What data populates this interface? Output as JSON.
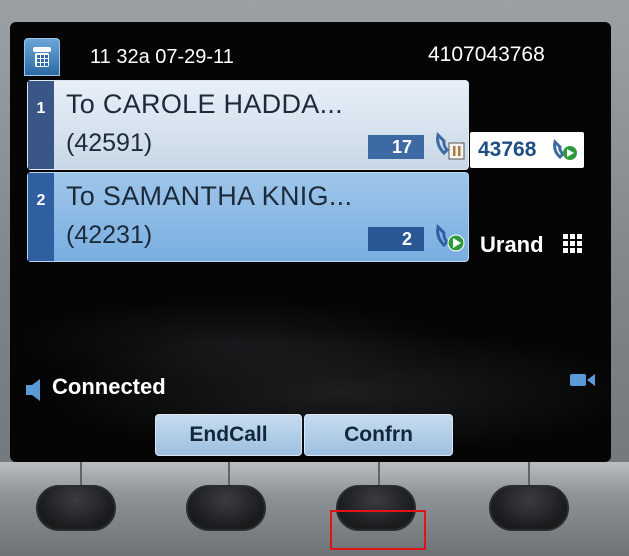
{
  "status_bar": {
    "datetime": "11 32a 07-29-11",
    "phone_number": "4107043768"
  },
  "calls": [
    {
      "index": "1",
      "name": "To CAROLE HADDA...",
      "extension": "(42591)",
      "timer": "17",
      "state": "hold",
      "selected": false
    },
    {
      "index": "2",
      "name": "To SAMANTHA KNIG...",
      "extension": "(42231)",
      "timer": "2",
      "state": "active",
      "selected": true
    }
  ],
  "side_lines": [
    {
      "label": "43768",
      "icon": "phone-active-icon"
    },
    {
      "label": "Urand",
      "icon": "grid-icon"
    }
  ],
  "status": {
    "text": "Connected"
  },
  "softkeys": [
    {
      "label": "EndCall"
    },
    {
      "label": "Confrn"
    }
  ],
  "colors": {
    "screen_bg": "#050505",
    "selected_call": "#79aee0",
    "call_bg": "#e8f0f8",
    "softkey_bg": "#9dbfe0",
    "highlight": "#e01414"
  }
}
